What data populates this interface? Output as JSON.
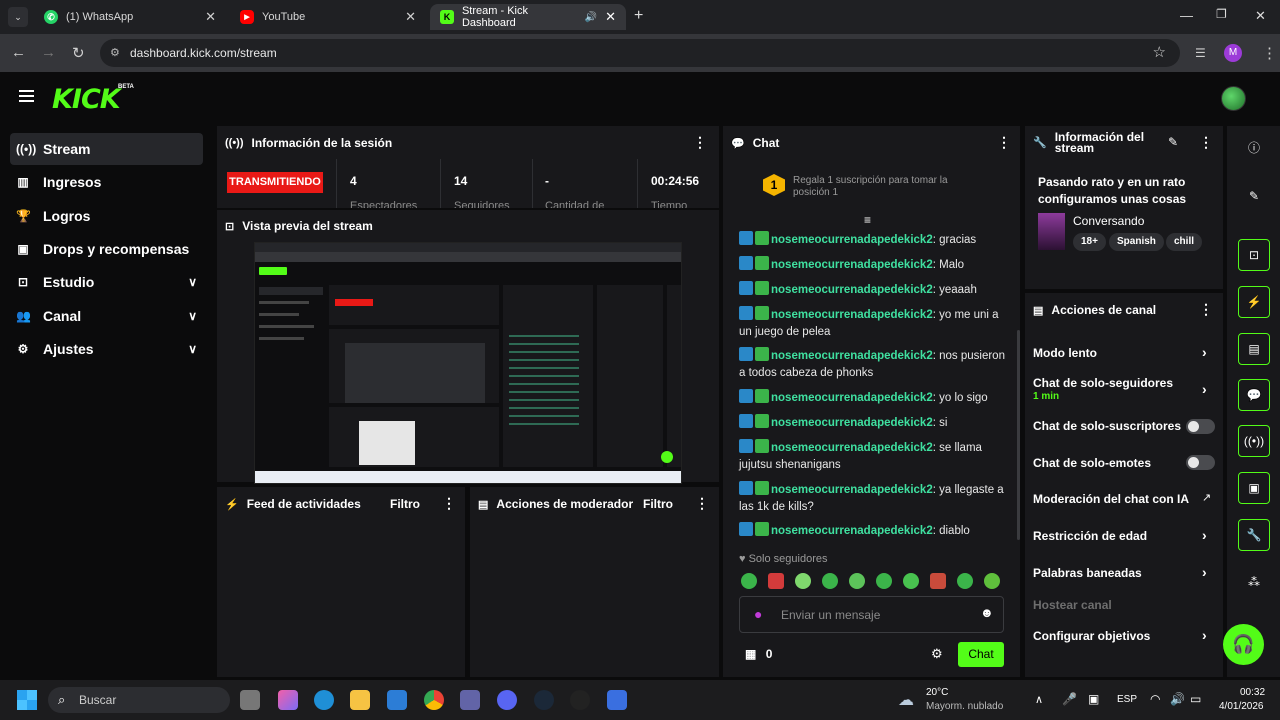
{
  "browser": {
    "tabs": [
      {
        "label": "(1) WhatsApp",
        "icon": "whatsapp-icon"
      },
      {
        "label": "YouTube",
        "icon": "youtube-icon"
      },
      {
        "label": "Stream - Kick Dashboard",
        "icon": "kick-icon"
      }
    ],
    "url": "dashboard.kick.com/stream",
    "profile_initial": "M"
  },
  "header": {
    "logo": "KICK",
    "beta": "BETA"
  },
  "sidebar": {
    "items": [
      {
        "label": "Stream",
        "icon": "broadcast-icon"
      },
      {
        "label": "Ingresos",
        "icon": "chart-icon"
      },
      {
        "label": "Logros",
        "icon": "trophy-icon"
      },
      {
        "label": "Drops y recompensas",
        "icon": "gift-icon"
      },
      {
        "label": "Estudio",
        "icon": "studio-icon"
      },
      {
        "label": "Canal",
        "icon": "users-icon"
      },
      {
        "label": "Ajustes",
        "icon": "gear-icon"
      }
    ]
  },
  "session": {
    "title": "Información de la sesión",
    "status": "TRANSMITIENDO",
    "stats": [
      {
        "value": "4",
        "label": "Espectadores"
      },
      {
        "value": "14",
        "label": "Seguidores"
      },
      {
        "value": "-",
        "label": "Cantidad de"
      },
      {
        "value": "00:24:56",
        "label": "Tiempo"
      }
    ]
  },
  "preview": {
    "title": "Vista previa del stream"
  },
  "feed": {
    "title": "Feed de actividades",
    "filter": "Filtro"
  },
  "modactions": {
    "title": "Acciones de moderador",
    "filter": "Filtro"
  },
  "chat": {
    "title": "Chat",
    "gift_rank": "1",
    "gift_text": "Regala 1 suscripción para tomar la posición 1",
    "messages": [
      {
        "user": "nosemeocurrenadapedekick2",
        "text": "gracias"
      },
      {
        "user": "nosemeocurrenadapedekick2",
        "text": "Malo"
      },
      {
        "user": "nosemeocurrenadapedekick2",
        "text": "yeaaah"
      },
      {
        "user": "nosemeocurrenadapedekick2",
        "text": "yo me uni a un juego de pelea"
      },
      {
        "user": "nosemeocurrenadapedekick2",
        "text": "nos pusieron a todos cabeza de phonks"
      },
      {
        "user": "nosemeocurrenadapedekick2",
        "text": "yo lo sigo"
      },
      {
        "user": "nosemeocurrenadapedekick2",
        "text": "si"
      },
      {
        "user": "nosemeocurrenadapedekick2",
        "text": "se llama jujutsu shenanigans"
      },
      {
        "user": "nosemeocurrenadapedekick2",
        "text": "ya llegaste a las 1k de kills?"
      },
      {
        "user": "nosemeocurrenadapedekick2",
        "text": "diablo"
      }
    ],
    "followers_only": "Solo seguidores",
    "placeholder": "Enviar un mensaje",
    "points": "0",
    "send": "Chat"
  },
  "stream_info": {
    "title": "Información del stream",
    "stream_title": "Pasando rato y en un rato configuramos unas cosas",
    "category": "Conversando",
    "tags": [
      "18+",
      "Spanish",
      "chill"
    ]
  },
  "channel_actions": {
    "title": "Acciones de canal",
    "items": [
      {
        "label": "Modo lento",
        "control": "chevron"
      },
      {
        "label": "Chat de solo-seguidores",
        "sub": "1 min",
        "control": "chevron"
      },
      {
        "label": "Chat de solo-suscriptores",
        "control": "toggle"
      },
      {
        "label": "Chat de solo-emotes",
        "control": "toggle"
      },
      {
        "label": "Moderación del chat con IA",
        "control": "external"
      },
      {
        "label": "Restricción de edad",
        "control": "chevron"
      },
      {
        "label": "Palabras baneadas",
        "control": "chevron"
      },
      {
        "label": "Hostear canal",
        "control": "none"
      },
      {
        "label": "Configurar objetivos",
        "control": "chevron"
      }
    ]
  },
  "taskbar": {
    "search": "Buscar",
    "weather_temp": "20°C",
    "weather_desc": "Mayorm. nublado",
    "lang": "ESP",
    "time": "00:32",
    "date": "4/01/2026"
  },
  "colors": {
    "accent": "#53fc18",
    "live": "#e91916",
    "username": "#3fe0a0"
  }
}
